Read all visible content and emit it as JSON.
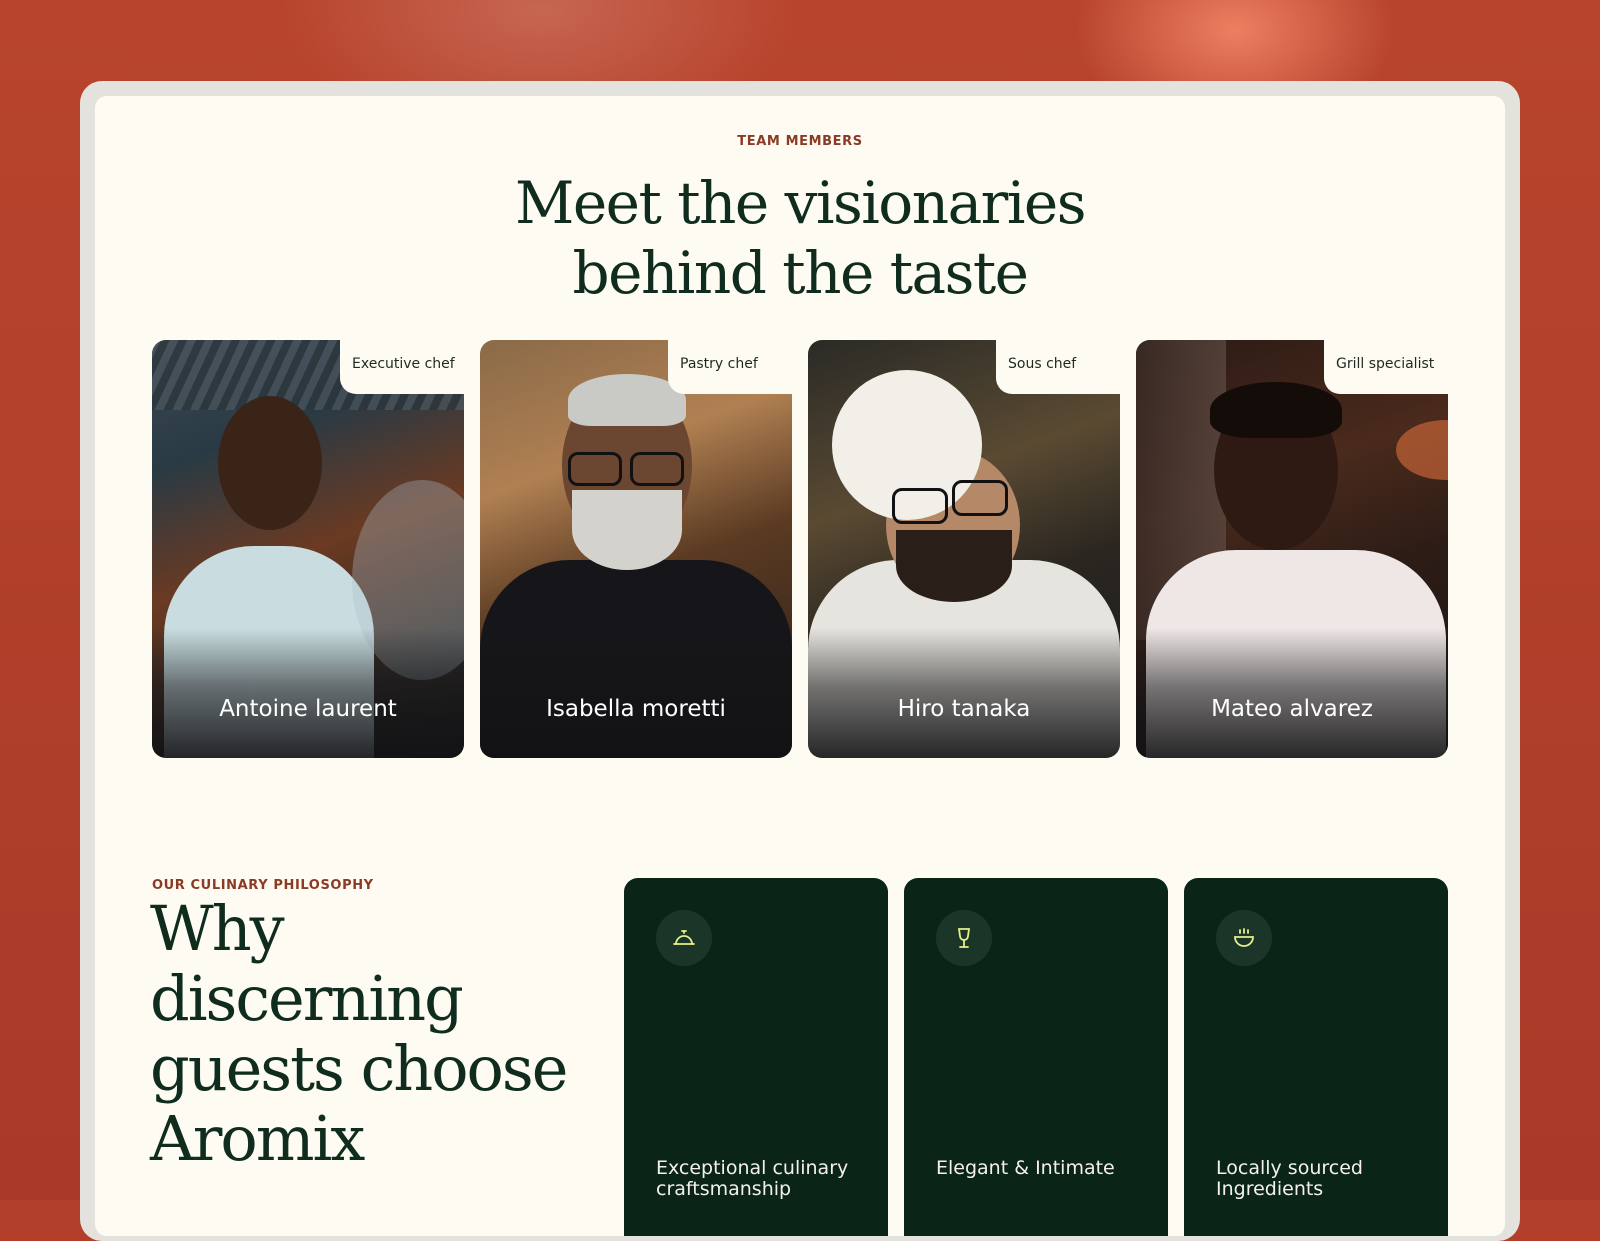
{
  "team": {
    "eyebrow": "TEAM MEMBERS",
    "title_line1": "Meet the visionaries",
    "title_line2": "behind the taste",
    "members": [
      {
        "role": "Executive chef",
        "name": "Antoine laurent"
      },
      {
        "role": "Pastry chef",
        "name": "Isabella moretti"
      },
      {
        "role": "Sous chef",
        "name": "Hiro tanaka"
      },
      {
        "role": "Grill specialist",
        "name": "Mateo alvarez"
      }
    ]
  },
  "philosophy": {
    "eyebrow": "OUR CULINARY PHILOSOPHY",
    "title": "Why discerning guests choose Aromix",
    "features": [
      {
        "icon": "cloche-icon",
        "title": "Exceptional culinary craftsmanship"
      },
      {
        "icon": "wine-glass-icon",
        "title": "Elegant & Intimate"
      },
      {
        "icon": "bowl-icon",
        "title": "Locally sourced Ingredients"
      }
    ]
  },
  "colors": {
    "background": "#b13f2b",
    "page": "#fdfbf2",
    "accent_dark_green": "#0b2418",
    "eyebrow": "#8a3a25",
    "icon_accent": "#e6ef8a"
  }
}
